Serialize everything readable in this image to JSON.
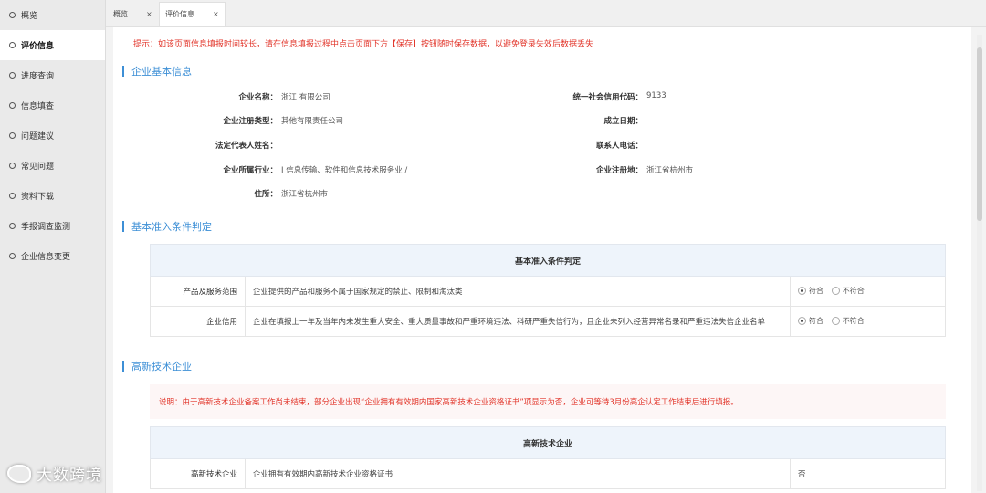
{
  "sidebar": {
    "items": [
      {
        "label": "概览",
        "active": false
      },
      {
        "label": "评价信息",
        "active": true
      },
      {
        "label": "进度查询",
        "active": false
      },
      {
        "label": "信息填查",
        "active": false
      },
      {
        "label": "问题建议",
        "active": false
      },
      {
        "label": "常见问题",
        "active": false
      },
      {
        "label": "资料下载",
        "active": false
      },
      {
        "label": "季报调查监测",
        "active": false
      },
      {
        "label": "企业信息变更",
        "active": false
      }
    ]
  },
  "watermark": "大数跨境",
  "tabs": [
    {
      "label": "概览",
      "close": "×",
      "active": false
    },
    {
      "label": "评价信息",
      "close": "×",
      "active": true
    }
  ],
  "tip": "提示：如该页面信息填报时间较长，请在信息填报过程中点击页面下方【保存】按钮随时保存数据，以避免登录失效后数据丢失",
  "basic_info": {
    "title": "企业基本信息",
    "company_name_label": "企业名称：",
    "company_name_value": "浙江                              有限公司",
    "credit_code_label": "统一社会信用代码：",
    "credit_code_value": "9133",
    "reg_type_label": "企业注册类型：",
    "reg_type_value": "其他有限责任公司",
    "founded_label": "成立日期：",
    "founded_value": "",
    "legal_rep_label": "法定代表人姓名：",
    "legal_rep_value": "",
    "phone_label": "联系人电话：",
    "phone_value": "",
    "industry_label": "企业所属行业：",
    "industry_value": "I 信息传输、软件和信息技术服务业 /",
    "reg_place_label": "企业注册地：",
    "reg_place_value": "浙江省杭州市",
    "address_label": "住所：",
    "address_value": "浙江省杭州市"
  },
  "basic_judge": {
    "section_title": "基本准入条件判定",
    "table_title": "基本准入条件判定",
    "rows": [
      {
        "label": "产品及服务范围",
        "text": "企业提供的产品和服务不属于国家规定的禁止、限制和淘汰类",
        "yes": "符合",
        "no": "不符合"
      },
      {
        "label": "企业信用",
        "text": "企业在填报上一年及当年内未发生重大安全、重大质量事故和严重环境违法、科研严重失信行为，且企业未列入经营异常名录和严重违法失信企业名单",
        "yes": "符合",
        "no": "不符合"
      }
    ]
  },
  "hightech": {
    "section_title": "高新技术企业",
    "note": "说明：由于高新技术企业备案工作尚未结束，部分企业出现“企业拥有有效期内国家高新技术企业资格证书”项显示为否，企业可等待3月份高企认定工作结束后进行填报。",
    "table_title": "高新技术企业",
    "row_label": "高新技术企业",
    "row_text": "企业拥有有效期内高新技术企业资格证书",
    "row_answer": "否"
  }
}
